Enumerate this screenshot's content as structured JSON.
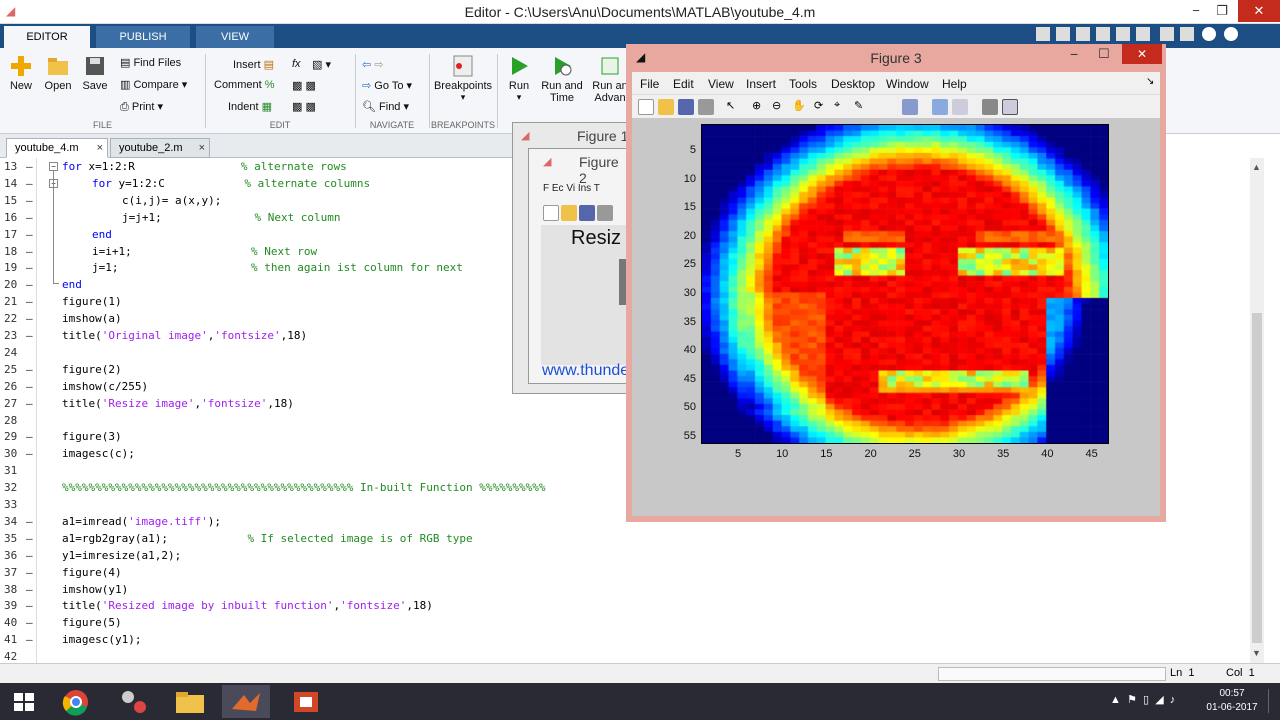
{
  "window": {
    "title": "Editor - C:\\Users\\Anu\\Documents\\MATLAB\\youtube_4.m",
    "minimize": "−",
    "restore": "❐",
    "close": "✕"
  },
  "ribbon_tabs": [
    "EDITOR",
    "PUBLISH",
    "VIEW"
  ],
  "ribbon": {
    "file": {
      "new": "New",
      "open": "Open",
      "save": "Save",
      "find_files": "Find Files",
      "compare": "Compare",
      "print": "Print",
      "section": "FILE"
    },
    "edit": {
      "insert": "Insert",
      "comment": "Comment",
      "indent": "Indent",
      "fx": "fx",
      "section": "EDIT"
    },
    "navigate": {
      "goto": "Go To",
      "find": "Find",
      "section": "NAVIGATE"
    },
    "breakpoints": {
      "label": "Breakpoints",
      "section": "BREAKPOINTS"
    },
    "run": {
      "run": "Run",
      "run_time": "Run and Time",
      "run_adv": "Run an Advan"
    }
  },
  "editor_tabs": [
    {
      "label": "youtube_4.m",
      "close": "×"
    },
    {
      "label": "youtube_2.m",
      "close": "×"
    }
  ],
  "code_lines": [
    {
      "n": "13",
      "html": "<span class='kw'>for</span> x=1:2:R                <span class='cm'>% alternate rows</span>",
      "indent": 0
    },
    {
      "n": "14",
      "html": "<span class='kw'>for</span> y=1:2:C            <span class='cm'>% alternate columns</span>",
      "indent": 1
    },
    {
      "n": "15",
      "html": "c(i,j)= a(x,y);",
      "indent": 2
    },
    {
      "n": "16",
      "html": "j=j+1;              <span class='cm'>% Next column</span>",
      "indent": 2
    },
    {
      "n": "17",
      "html": "<span class='kw'>end</span>",
      "indent": 1
    },
    {
      "n": "18",
      "html": "i=i+1;                  <span class='cm'>% Next row</span>",
      "indent": 1
    },
    {
      "n": "19",
      "html": "j=1;                    <span class='cm'>% then again ist column for next</span>",
      "indent": 1
    },
    {
      "n": "20",
      "html": "<span class='kw'>end</span>",
      "indent": 0
    },
    {
      "n": "21",
      "html": "figure(1)",
      "indent": 0
    },
    {
      "n": "22",
      "html": "imshow(a)",
      "indent": 0
    },
    {
      "n": "23",
      "html": "title(<span class='str'>'Original image'</span>,<span class='str'>'fontsize'</span>,18)",
      "indent": 0
    },
    {
      "n": "24",
      "html": "",
      "indent": 0
    },
    {
      "n": "25",
      "html": "figure(2)",
      "indent": 0
    },
    {
      "n": "26",
      "html": "imshow(c/255)",
      "indent": 0
    },
    {
      "n": "27",
      "html": "title(<span class='str'>'Resize image'</span>,<span class='str'>'fontsize'</span>,18)",
      "indent": 0
    },
    {
      "n": "28",
      "html": "",
      "indent": 0
    },
    {
      "n": "29",
      "html": "figure(3)",
      "indent": 0
    },
    {
      "n": "30",
      "html": "imagesc(c);",
      "indent": 0
    },
    {
      "n": "31",
      "html": "",
      "indent": 0
    },
    {
      "n": "32",
      "html": "<span class='cm'>%%%%%%%%%%%%%%%%%%%%%%%%%%%%%%%%%%%%%%%%%%%% In-built Function %%%%%%%%%%</span>",
      "indent": 0
    },
    {
      "n": "33",
      "html": "",
      "indent": 0
    },
    {
      "n": "34",
      "html": "a1=imread(<span class='str'>'image.tiff'</span>);",
      "indent": 0
    },
    {
      "n": "35",
      "html": "a1=rgb2gray(a1);            <span class='cm'>% If selected image is of RGB type</span>",
      "indent": 0
    },
    {
      "n": "36",
      "html": "y1=imresize(a1,2);",
      "indent": 0
    },
    {
      "n": "37",
      "html": "figure(4)",
      "indent": 0
    },
    {
      "n": "38",
      "html": "imshow(y1)",
      "indent": 0
    },
    {
      "n": "39",
      "html": "title(<span class='str'>'Resized image by inbuilt function'</span>,<span class='str'>'fontsize'</span>,18)",
      "indent": 0
    },
    {
      "n": "40",
      "html": "figure(5)",
      "indent": 0
    },
    {
      "n": "41",
      "html": "imagesc(y1);",
      "indent": 0
    },
    {
      "n": "42",
      "html": "",
      "indent": 0
    }
  ],
  "dash_lines": [
    "13",
    "14",
    "15",
    "16",
    "17",
    "18",
    "19",
    "20",
    "21",
    "22",
    "23",
    "25",
    "26",
    "27",
    "29",
    "30",
    "34",
    "35",
    "36",
    "37",
    "38",
    "39",
    "40",
    "41"
  ],
  "figure1": {
    "title": "Figure 1"
  },
  "figure2": {
    "title": "Figure 2",
    "menu_fragment": "F  Ec  Vi  Ins  T",
    "axes_title_fragment": "Resiz"
  },
  "figure3": {
    "title": "Figure 3",
    "menu": [
      "File",
      "Edit",
      "View",
      "Insert",
      "Tools",
      "Desktop",
      "Window",
      "Help"
    ],
    "yticks": [
      "5",
      "10",
      "15",
      "20",
      "25",
      "30",
      "35",
      "40",
      "45",
      "50",
      "55"
    ],
    "xticks": [
      "5",
      "10",
      "15",
      "20",
      "25",
      "30",
      "35",
      "40",
      "45"
    ]
  },
  "watermark": "www.thundershare.net",
  "status": {
    "ln_label": "Ln",
    "ln": "1",
    "col_label": "Col",
    "col": "1"
  },
  "taskbar": {
    "time": "00:57",
    "date": "01-06-2017"
  },
  "colors": {
    "ribbon_dark": "#1d4e83",
    "jet_red": "#e8241a",
    "jet_blue": "#1038ff"
  }
}
